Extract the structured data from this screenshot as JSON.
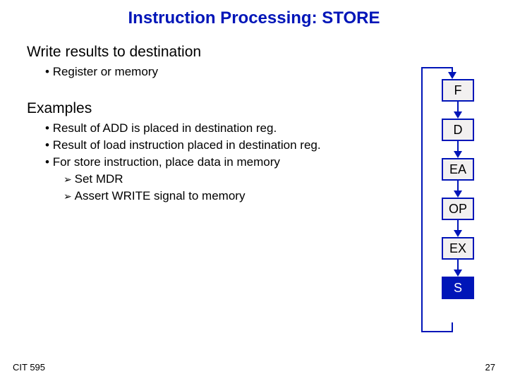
{
  "title": "Instruction Processing: STORE",
  "sections": {
    "s1": {
      "heading": "Write results to destination",
      "bullets": [
        "Register or memory"
      ]
    },
    "s2": {
      "heading": "Examples",
      "bullets": [
        "Result of ADD is placed in destination reg.",
        "Result of load instruction placed in destination reg.",
        "For store instruction, place data in memory"
      ],
      "subbullets": [
        "Set MDR",
        "Assert WRITE signal to memory"
      ]
    }
  },
  "stages": [
    "F",
    "D",
    "EA",
    "OP",
    "EX",
    "S"
  ],
  "active_stage": "S",
  "footer": {
    "course": "CIT 595",
    "page": "27"
  }
}
